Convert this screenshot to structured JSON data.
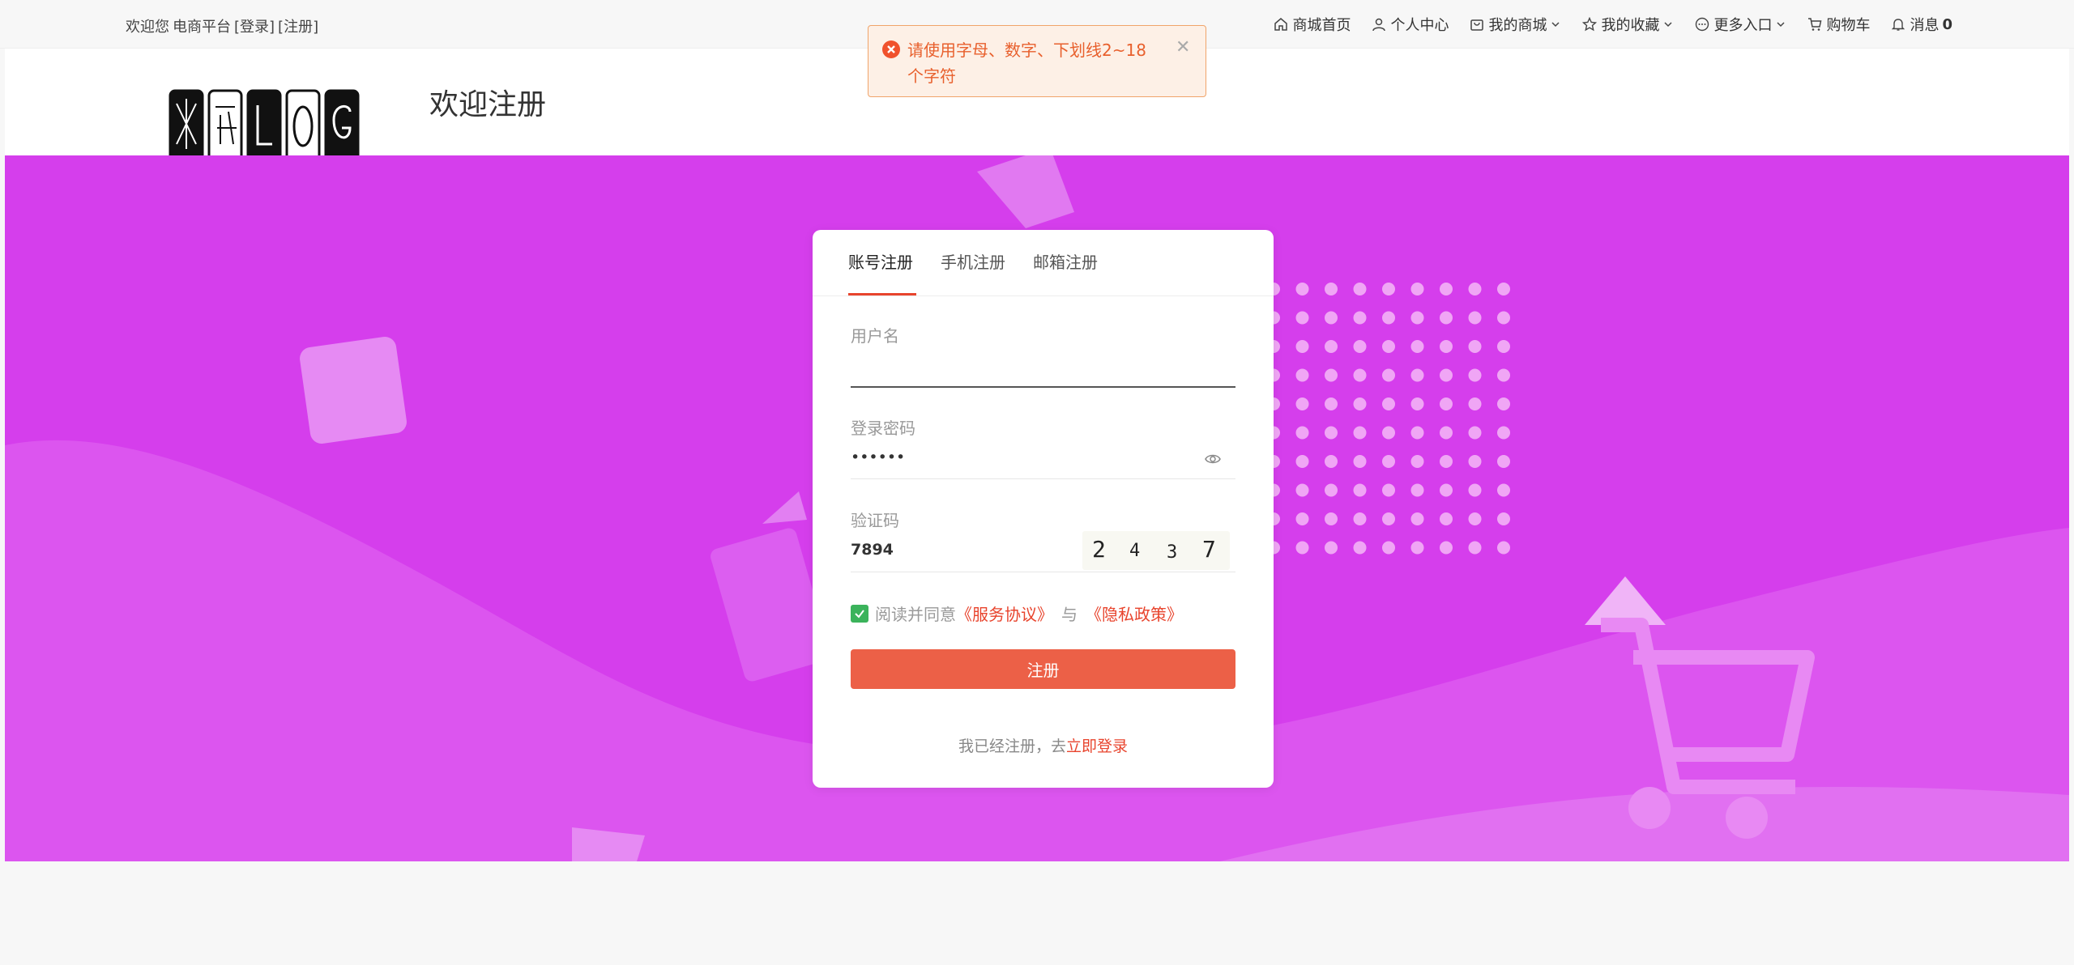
{
  "topbar": {
    "welcome": "欢迎您",
    "platform": "电商平台",
    "login": "[登录]",
    "register": "[注册]"
  },
  "nav": {
    "home": "商城首页",
    "profile": "个人中心",
    "mall": "我的商城",
    "favorites": "我的收藏",
    "more": "更多入口",
    "cart": "购物车",
    "messages": "消息",
    "message_count": "0"
  },
  "header": {
    "title": "欢迎注册"
  },
  "toast": {
    "message": "请使用字母、数字、下划线2~18个字符"
  },
  "form": {
    "tabs": [
      "账号注册",
      "手机注册",
      "邮箱注册"
    ],
    "username_label": "用户名",
    "username_value": "",
    "password_label": "登录密码",
    "password_value": "••••••",
    "captcha_label": "验证码",
    "captcha_value": "7894",
    "captcha_chars": [
      "2",
      "4",
      "3",
      "7"
    ],
    "agree_text": "阅读并同意",
    "service_link": "《服务协议》",
    "and_text": "与",
    "privacy_link": "《隐私政策》",
    "submit_label": "注册",
    "login_prompt": "我已经注册，去",
    "login_link": "立即登录"
  },
  "colors": {
    "banner": "#d53eec",
    "accent": "#e8442d",
    "button": "#ec6047",
    "checkbox": "#3bb35b"
  },
  "icons": [
    "home-icon",
    "user-icon",
    "mall-icon",
    "star-icon",
    "more-icon",
    "cart-icon",
    "bell-icon",
    "eye-icon",
    "error-icon",
    "close-icon"
  ]
}
